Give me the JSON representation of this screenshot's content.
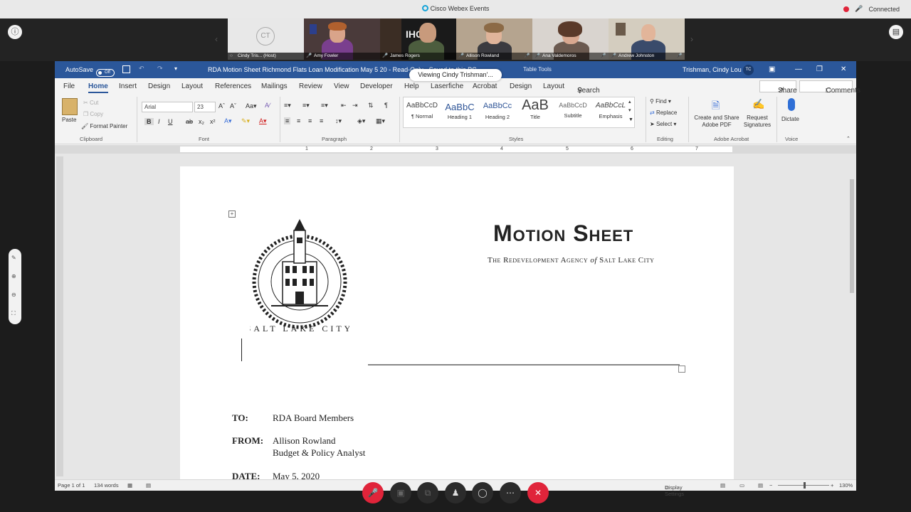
{
  "webex": {
    "app_title": "Cisco Webex Events",
    "status": "Connected",
    "participants": [
      {
        "name": "Cindy Tris...  (Host)",
        "initials": "CT"
      },
      {
        "name": "Amy Fowler"
      },
      {
        "name": "James Rogers"
      },
      {
        "name": "Allison Rowland"
      },
      {
        "name": "Ana Valdemoros"
      },
      {
        "name": "Andrew Johnston"
      }
    ],
    "viewing_label": "Viewing Cindy Trishman'..."
  },
  "word": {
    "autosave_label": "AutoSave",
    "autosave_state": "Off",
    "doc_title": "RDA Motion Sheet Richmond Flats Loan Modification May 5 20  -  Read-Only  -  Saved to this PC",
    "table_tools": "Table Tools",
    "user_name": "Trishman, Cindy Lou",
    "user_initials": "TC",
    "tabs": [
      "File",
      "Home",
      "Insert",
      "Design",
      "Layout",
      "References",
      "Mailings",
      "Review",
      "View",
      "Developer",
      "Help",
      "Laserfiche",
      "Acrobat",
      "Design",
      "Layout"
    ],
    "search_label": "Search",
    "share_label": "Share",
    "comments_label": "Comments",
    "ribbon": {
      "paste": "Paste",
      "cut": "Cut",
      "copy": "Copy",
      "format_painter": "Format Painter",
      "clipboard": "Clipboard",
      "font_name": "Arial",
      "font_size": "23",
      "font_group": "Font",
      "paragraph_group": "Paragraph",
      "styles": [
        {
          "preview": "AaBbCcD",
          "name": "¶ Normal"
        },
        {
          "preview": "AaBbC",
          "name": "Heading 1"
        },
        {
          "preview": "AaBbCc",
          "name": "Heading 2"
        },
        {
          "preview": "AaB",
          "name": "Title"
        },
        {
          "preview": "AaBbCcD",
          "name": "Subtitle"
        },
        {
          "preview": "AaBbCcL",
          "name": "Emphasis"
        }
      ],
      "styles_group": "Styles",
      "find": "Find",
      "replace": "Replace",
      "select": "Select",
      "editing_group": "Editing",
      "create_share_pdf": "Create and Share Adobe PDF",
      "request_signatures": "Request Signatures",
      "acrobat_group": "Adobe Acrobat",
      "dictate": "Dictate",
      "voice_group": "Voice"
    },
    "ruler_numbers": [
      "1",
      "2",
      "3",
      "4",
      "5",
      "6",
      "7"
    ],
    "document": {
      "title": "Motion Sheet",
      "agency_pre": "The Redevelopment Agency",
      "agency_of": "of",
      "agency_post": "Salt Lake City",
      "seal_text": "SALT LAKE CITY",
      "to_label": "TO:",
      "to_value": "RDA Board Members",
      "from_label": "FROM:",
      "from_name": "Allison Rowland",
      "from_title": "Budget & Policy Analyst",
      "date_label": "DATE:",
      "date_value": "May 5, 2020"
    },
    "status": {
      "page": "Page 1 of 1",
      "words": "134 words",
      "display_settings": "Display Settings",
      "zoom": "130%"
    }
  }
}
